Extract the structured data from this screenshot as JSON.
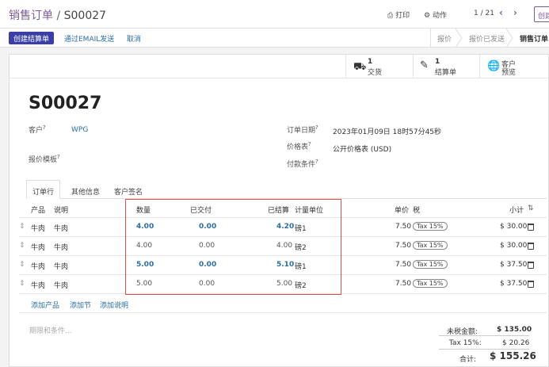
{
  "header": {
    "breadcrumb_root": "销售订单",
    "breadcrumb_sep": "/",
    "breadcrumb_current": "S00027",
    "print_label": "打印",
    "action_label": "动作",
    "pager": "1 / 21",
    "create_label": "创建"
  },
  "actions": {
    "create_invoice": "创建结算单",
    "send_email": "通过EMAIL发送",
    "cancel": "取消"
  },
  "statusbar": [
    "报价",
    "报价已发送",
    "销售订单"
  ],
  "smart_buttons": {
    "delivery_count": "1",
    "delivery_label": "交货",
    "invoice_count": "1",
    "invoice_label": "结算单",
    "preview_line1": "客户",
    "preview_line2": "预览"
  },
  "form": {
    "title": "S00027",
    "customer_label": "客户",
    "customer_value": "WPG",
    "template_label": "报价模板",
    "order_date_label": "订单日期",
    "order_date_value": "2023年01月09日 18时57分45秒",
    "pricelist_label": "价格表",
    "pricelist_value": "公开价格表 (USD)",
    "payment_terms_label": "付款条件",
    "help_mark": "?"
  },
  "tabs": [
    "订单行",
    "其他信息",
    "客户签名"
  ],
  "table": {
    "headers": {
      "product": "产品",
      "description": "说明",
      "qty": "数量",
      "delivered": "已交付",
      "invoiced": "已结算",
      "uom": "计量单位",
      "price": "单价",
      "tax": "税",
      "subtotal": "小计"
    },
    "rows": [
      {
        "product": "牛肉",
        "description": "牛肉",
        "qty": "4.00",
        "delivered": "0.00",
        "invoiced": "4.20",
        "uom": "磅1",
        "price": "7.50",
        "tax": "Tax 15%",
        "subtotal": "$ 30.00"
      },
      {
        "product": "牛肉",
        "description": "牛肉",
        "qty": "4.00",
        "delivered": "0.00",
        "invoiced": "4.00",
        "uom": "磅2",
        "price": "7.50",
        "tax": "Tax 15%",
        "subtotal": "$ 30.00"
      },
      {
        "product": "牛肉",
        "description": "牛肉",
        "qty": "5.00",
        "delivered": "0.00",
        "invoiced": "5.10",
        "uom": "磅1",
        "price": "7.50",
        "tax": "Tax 15%",
        "subtotal": "$ 37.50"
      },
      {
        "product": "牛肉",
        "description": "牛肉",
        "qty": "5.00",
        "delivered": "0.00",
        "invoiced": "5.00",
        "uom": "磅2",
        "price": "7.50",
        "tax": "Tax 15%",
        "subtotal": "$ 37.50"
      }
    ],
    "add_product": "添加产品",
    "add_section": "添加节",
    "add_note": "添加说明"
  },
  "terms_placeholder": "期限和条件...",
  "totals": {
    "untaxed_label": "未税金额:",
    "untaxed_value": "$ 135.00",
    "tax_label": "Tax 15%:",
    "tax_value": "$ 20.26",
    "total_label": "合计:",
    "total_value": "$ 155.26"
  },
  "colors": {
    "brand": "#7c5b9b",
    "primary_button": "#3b3fa5",
    "link": "#2b6da3",
    "highlight_box": "#e05050"
  }
}
